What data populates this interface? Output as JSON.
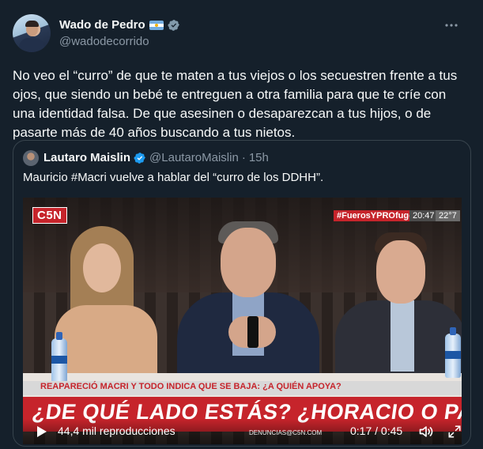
{
  "tweet": {
    "display_name": "Wado de Pedro",
    "handle": "@wadodecorrido",
    "text": "No veo el “curro” de que te maten a tus viejos o los secuestren frente a tus ojos, que siendo un bebé te entreguen a otra familia para que te críe con una identidad falsa. De que asesinen o desaparezcan a tus hijos, o de pasarte más de 40 años buscando a tus nietos.",
    "icons": {
      "flag": "argentina-flag-icon",
      "verified": "gray-verified-badge-icon",
      "more": "more-options-icon"
    }
  },
  "quote": {
    "display_name": "Lautaro Maislin",
    "handle": "@LautaroMaislin",
    "separator": "·",
    "time": "15h",
    "text": "Mauricio #Macri vuelve a hablar del “curro de los DDHH”.",
    "verified_color": "#1d9bf0"
  },
  "video": {
    "channel_logo": "C5N",
    "hashtag": "#FuerosYPROfugos",
    "clock": "20:47",
    "temperature": "22°7",
    "lower_third": "REAPARECIÓ MACRI Y TODO INDICA QUE SE BAJA: ¿A QUIÉN APOYA?",
    "headline": "¿DE QUÉ LADO ESTÁS? ¿HORACIO O PATRICIA?",
    "ticker": "DENUNCIAS@C5N.COM",
    "views": "44,4 mil reproducciones",
    "duration": "0:17 / 0:45",
    "accent_color": "#c6242b"
  }
}
